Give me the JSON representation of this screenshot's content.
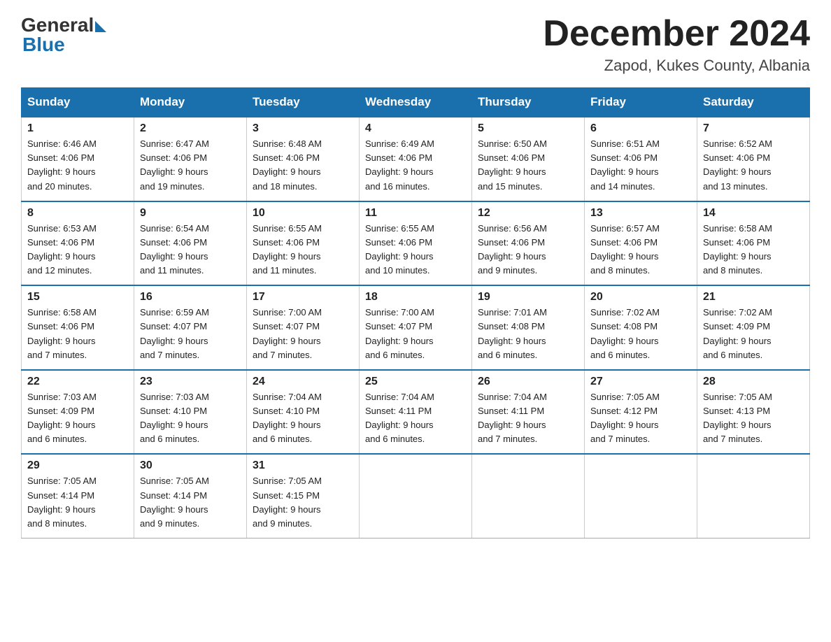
{
  "header": {
    "logo_general": "General",
    "logo_blue": "Blue",
    "month_title": "December 2024",
    "location": "Zapod, Kukes County, Albania"
  },
  "weekdays": [
    "Sunday",
    "Monday",
    "Tuesday",
    "Wednesday",
    "Thursday",
    "Friday",
    "Saturday"
  ],
  "weeks": [
    [
      {
        "day": "1",
        "sunrise": "6:46 AM",
        "sunset": "4:06 PM",
        "daylight": "9 hours and 20 minutes."
      },
      {
        "day": "2",
        "sunrise": "6:47 AM",
        "sunset": "4:06 PM",
        "daylight": "9 hours and 19 minutes."
      },
      {
        "day": "3",
        "sunrise": "6:48 AM",
        "sunset": "4:06 PM",
        "daylight": "9 hours and 18 minutes."
      },
      {
        "day": "4",
        "sunrise": "6:49 AM",
        "sunset": "4:06 PM",
        "daylight": "9 hours and 16 minutes."
      },
      {
        "day": "5",
        "sunrise": "6:50 AM",
        "sunset": "4:06 PM",
        "daylight": "9 hours and 15 minutes."
      },
      {
        "day": "6",
        "sunrise": "6:51 AM",
        "sunset": "4:06 PM",
        "daylight": "9 hours and 14 minutes."
      },
      {
        "day": "7",
        "sunrise": "6:52 AM",
        "sunset": "4:06 PM",
        "daylight": "9 hours and 13 minutes."
      }
    ],
    [
      {
        "day": "8",
        "sunrise": "6:53 AM",
        "sunset": "4:06 PM",
        "daylight": "9 hours and 12 minutes."
      },
      {
        "day": "9",
        "sunrise": "6:54 AM",
        "sunset": "4:06 PM",
        "daylight": "9 hours and 11 minutes."
      },
      {
        "day": "10",
        "sunrise": "6:55 AM",
        "sunset": "4:06 PM",
        "daylight": "9 hours and 11 minutes."
      },
      {
        "day": "11",
        "sunrise": "6:55 AM",
        "sunset": "4:06 PM",
        "daylight": "9 hours and 10 minutes."
      },
      {
        "day": "12",
        "sunrise": "6:56 AM",
        "sunset": "4:06 PM",
        "daylight": "9 hours and 9 minutes."
      },
      {
        "day": "13",
        "sunrise": "6:57 AM",
        "sunset": "4:06 PM",
        "daylight": "9 hours and 8 minutes."
      },
      {
        "day": "14",
        "sunrise": "6:58 AM",
        "sunset": "4:06 PM",
        "daylight": "9 hours and 8 minutes."
      }
    ],
    [
      {
        "day": "15",
        "sunrise": "6:58 AM",
        "sunset": "4:06 PM",
        "daylight": "9 hours and 7 minutes."
      },
      {
        "day": "16",
        "sunrise": "6:59 AM",
        "sunset": "4:07 PM",
        "daylight": "9 hours and 7 minutes."
      },
      {
        "day": "17",
        "sunrise": "7:00 AM",
        "sunset": "4:07 PM",
        "daylight": "9 hours and 7 minutes."
      },
      {
        "day": "18",
        "sunrise": "7:00 AM",
        "sunset": "4:07 PM",
        "daylight": "9 hours and 6 minutes."
      },
      {
        "day": "19",
        "sunrise": "7:01 AM",
        "sunset": "4:08 PM",
        "daylight": "9 hours and 6 minutes."
      },
      {
        "day": "20",
        "sunrise": "7:02 AM",
        "sunset": "4:08 PM",
        "daylight": "9 hours and 6 minutes."
      },
      {
        "day": "21",
        "sunrise": "7:02 AM",
        "sunset": "4:09 PM",
        "daylight": "9 hours and 6 minutes."
      }
    ],
    [
      {
        "day": "22",
        "sunrise": "7:03 AM",
        "sunset": "4:09 PM",
        "daylight": "9 hours and 6 minutes."
      },
      {
        "day": "23",
        "sunrise": "7:03 AM",
        "sunset": "4:10 PM",
        "daylight": "9 hours and 6 minutes."
      },
      {
        "day": "24",
        "sunrise": "7:04 AM",
        "sunset": "4:10 PM",
        "daylight": "9 hours and 6 minutes."
      },
      {
        "day": "25",
        "sunrise": "7:04 AM",
        "sunset": "4:11 PM",
        "daylight": "9 hours and 6 minutes."
      },
      {
        "day": "26",
        "sunrise": "7:04 AM",
        "sunset": "4:11 PM",
        "daylight": "9 hours and 7 minutes."
      },
      {
        "day": "27",
        "sunrise": "7:05 AM",
        "sunset": "4:12 PM",
        "daylight": "9 hours and 7 minutes."
      },
      {
        "day": "28",
        "sunrise": "7:05 AM",
        "sunset": "4:13 PM",
        "daylight": "9 hours and 7 minutes."
      }
    ],
    [
      {
        "day": "29",
        "sunrise": "7:05 AM",
        "sunset": "4:14 PM",
        "daylight": "9 hours and 8 minutes."
      },
      {
        "day": "30",
        "sunrise": "7:05 AM",
        "sunset": "4:14 PM",
        "daylight": "9 hours and 9 minutes."
      },
      {
        "day": "31",
        "sunrise": "7:05 AM",
        "sunset": "4:15 PM",
        "daylight": "9 hours and 9 minutes."
      },
      null,
      null,
      null,
      null
    ]
  ],
  "labels": {
    "sunrise": "Sunrise:",
    "sunset": "Sunset:",
    "daylight": "Daylight:"
  }
}
